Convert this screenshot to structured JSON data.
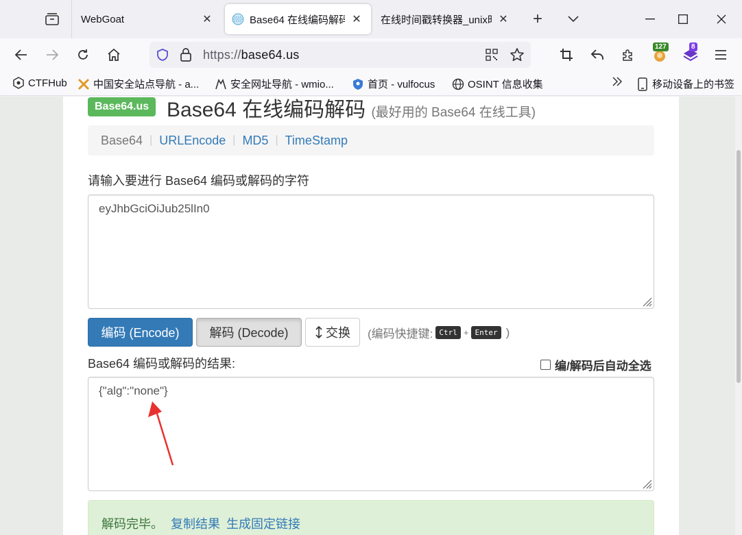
{
  "browser": {
    "tabs": [
      {
        "title": "WebGoat",
        "active": false
      },
      {
        "title": "Base64 在线编码解码",
        "active": true
      },
      {
        "title": "在线时间戳转换器_unix时",
        "active": false
      }
    ],
    "url": {
      "scheme": "https://",
      "host": "base64.us"
    },
    "extension_badges": {
      "counter_a": "127",
      "counter_b": "8"
    },
    "bookmarks": [
      {
        "label": "CTFHub",
        "icon": "ctfhub-icon"
      },
      {
        "label": "中国安全站点导航 - a...",
        "icon": "crossed-swords-icon"
      },
      {
        "label": "安全网址导航 - wmio...",
        "icon": "wolf-icon"
      },
      {
        "label": "首页 - vulfocus",
        "icon": "shield-icon"
      },
      {
        "label": "OSINT 信息收集",
        "icon": "globe-icon"
      }
    ],
    "mobile_bookmarks": "移动设备上的书签"
  },
  "page": {
    "logo": "Base64.us",
    "title": "Base64 在线编码解码",
    "subtitle": "(最好用的 Base64 在线工具)",
    "nav": [
      {
        "label": "Base64",
        "current": true
      },
      {
        "label": "URLEncode",
        "current": false
      },
      {
        "label": "MD5",
        "current": false
      },
      {
        "label": "TimeStamp",
        "current": false
      }
    ],
    "input_label": "请输入要进行 Base64 编码或解码的字符",
    "input_value": "eyJhbGciOiJub25lIn0",
    "buttons": {
      "encode": "编码 (Encode)",
      "decode": "解码 (Decode)",
      "swap": "交换"
    },
    "shortcut": {
      "prefix": "(编码快捷键:",
      "key1": "Ctrl",
      "plus": "+",
      "key2": "Enter",
      "suffix": ")"
    },
    "result_label": "Base64 编码或解码的结果:",
    "auto_select_label": "编/解码后自动全选",
    "result_value": "{\"alg\":\"none\"}",
    "alert": {
      "text": "解码完毕。",
      "copy_link": "复制结果",
      "permalink": "生成固定链接"
    }
  },
  "colors": {
    "primary": "#337ab7",
    "logo_green": "#5cb85c",
    "alert_bg": "#dff0d8",
    "annotation_arrow": "#e8312f"
  }
}
